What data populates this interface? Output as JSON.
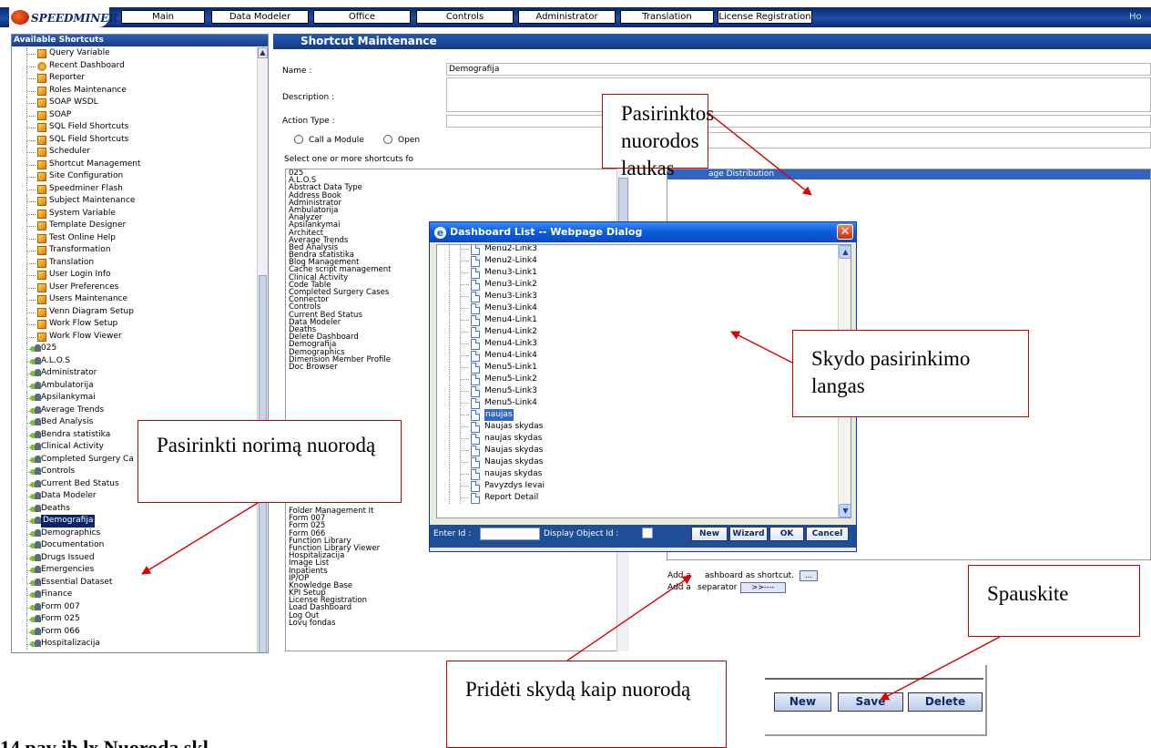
{
  "app": {
    "logo_text": "SPEEDMINER",
    "nav": [
      "Main",
      "Data Modeler",
      "Office",
      "Controls",
      "Administrator",
      "Translation",
      "License Registration"
    ],
    "nav_overflow": "Ho"
  },
  "sidebar": {
    "title": "Available Shortcuts",
    "items": [
      {
        "label": "Query Variable",
        "kind": "shortcut"
      },
      {
        "label": "Recent Dashboard",
        "kind": "recent"
      },
      {
        "label": "Reporter",
        "kind": "shortcut"
      },
      {
        "label": "Roles Maintenance",
        "kind": "shortcut"
      },
      {
        "label": "SOAP WSDL",
        "kind": "shortcut"
      },
      {
        "label": "SOAP",
        "kind": "shortcut"
      },
      {
        "label": "SQL Field Shortcuts",
        "kind": "shortcut"
      },
      {
        "label": "SQL Field Shortcuts",
        "kind": "shortcut"
      },
      {
        "label": "Scheduler",
        "kind": "shortcut"
      },
      {
        "label": "Shortcut Management",
        "kind": "shortcut"
      },
      {
        "label": "Site Configuration",
        "kind": "shortcut"
      },
      {
        "label": "Speedminer Flash",
        "kind": "shortcut"
      },
      {
        "label": "Subject Maintenance",
        "kind": "shortcut"
      },
      {
        "label": "System Variable",
        "kind": "shortcut"
      },
      {
        "label": "Template Designer",
        "kind": "shortcut"
      },
      {
        "label": "Test Online Help",
        "kind": "shortcut"
      },
      {
        "label": "Transformation",
        "kind": "shortcut"
      },
      {
        "label": "Translation",
        "kind": "shortcut"
      },
      {
        "label": "User Login Info",
        "kind": "shortcut"
      },
      {
        "label": "User Preferences",
        "kind": "shortcut"
      },
      {
        "label": "Users Maintenance",
        "kind": "shortcut"
      },
      {
        "label": "Venn Diagram Setup",
        "kind": "shortcut"
      },
      {
        "label": "Work Flow Setup",
        "kind": "shortcut"
      },
      {
        "label": "Work Flow Viewer",
        "kind": "shortcut"
      },
      {
        "label": "025",
        "kind": "dashboard"
      },
      {
        "label": "A.L.O.S",
        "kind": "dashboard"
      },
      {
        "label": "Administrator",
        "kind": "dashboard"
      },
      {
        "label": "Ambulatorija",
        "kind": "dashboard"
      },
      {
        "label": "Apsilankymai",
        "kind": "dashboard"
      },
      {
        "label": "Average Trends",
        "kind": "dashboard"
      },
      {
        "label": "Bed Analysis",
        "kind": "dashboard"
      },
      {
        "label": "Bendra statistika",
        "kind": "dashboard"
      },
      {
        "label": "Clinical Activity",
        "kind": "dashboard"
      },
      {
        "label": "Completed Surgery Ca",
        "kind": "dashboard"
      },
      {
        "label": "Controls",
        "kind": "dashboard"
      },
      {
        "label": "Current Bed Status",
        "kind": "dashboard"
      },
      {
        "label": "Data Modeler",
        "kind": "dashboard"
      },
      {
        "label": "Deaths",
        "kind": "dashboard"
      },
      {
        "label": "Demografija",
        "kind": "dashboard",
        "selected": true
      },
      {
        "label": "Demographics",
        "kind": "dashboard"
      },
      {
        "label": "Documentation",
        "kind": "dashboard"
      },
      {
        "label": "Drugs Issued",
        "kind": "dashboard"
      },
      {
        "label": "Emergencies",
        "kind": "dashboard"
      },
      {
        "label": "Essential Dataset",
        "kind": "dashboard"
      },
      {
        "label": "Finance",
        "kind": "dashboard"
      },
      {
        "label": "Form 007",
        "kind": "dashboard"
      },
      {
        "label": "Form 025",
        "kind": "dashboard"
      },
      {
        "label": "Form 066",
        "kind": "dashboard"
      },
      {
        "label": "Hospitalizacija",
        "kind": "dashboard"
      }
    ]
  },
  "main": {
    "title": "Shortcut Maintenance",
    "name_label": "Name :",
    "name_value": "Demografija",
    "description_label": "Description :",
    "action_type_label": "Action Type :",
    "radio_call_module": "Call a Module",
    "radio_open_partial": "Open",
    "select_label": "Select one or more shortcuts fo",
    "available_list": [
      "025",
      "A.L.O.S",
      "Abstract Data Type",
      "Address Book",
      "Administrator",
      "Ambulatorija",
      "Analyzer",
      "Apsilankymai",
      "Architect",
      "Average Trends",
      "Bed Analysis",
      "Bendra statistika",
      "Blog Management",
      "Cache script management",
      "Clinical Activity",
      "Code Table",
      "Completed Surgery Cases",
      "Connector",
      "Controls",
      "Current Bed Status",
      "Data Modeler",
      "Deaths",
      "Delete Dashboard",
      "Demografija",
      "Demographics",
      "Dimension Member Profile",
      "Doc Browser"
    ],
    "available_list_bottom": [
      "Folder Management It",
      "Form 007",
      "Form 025",
      "Form 066",
      "Function Library",
      "Function Library Viewer",
      "Hospitalizacija",
      "Image List",
      "Inpatients",
      "IP/OP",
      "Knowledge Base",
      "KPI Setup",
      "License Registration",
      "Load Dashboard",
      "Log Out",
      "Lovų fondas"
    ],
    "selected_row_partial": "age Distribution",
    "add_dashboard_label_a": "Add a",
    "add_dashboard_label_b": "ashboard as shortcut.",
    "add_dashboard_btn": "...",
    "add_separator_label_a": "Add a",
    "add_separator_label_b": "separator",
    "add_separator_btn": ">>----"
  },
  "buttons": {
    "new": "New",
    "save": "Save",
    "delete": "Delete"
  },
  "dialog": {
    "title": "Dashboard List -- Webpage Dialog",
    "ie_icon": "e",
    "close": "✕",
    "items": [
      {
        "label": "Menu2-Link3"
      },
      {
        "label": "Menu2-Link4"
      },
      {
        "label": "Menu3-Link1"
      },
      {
        "label": "Menu3-Link2"
      },
      {
        "label": "Menu3-Link3"
      },
      {
        "label": "Menu3-Link4"
      },
      {
        "label": "Menu4-Link1"
      },
      {
        "label": "Menu4-Link2"
      },
      {
        "label": "Menu4-Link3"
      },
      {
        "label": "Menu4-Link4"
      },
      {
        "label": "Menu5-Link1"
      },
      {
        "label": "Menu5-Link2"
      },
      {
        "label": "Menu5-Link3"
      },
      {
        "label": "Menu5-Link4"
      },
      {
        "label": "naujas",
        "selected": true
      },
      {
        "label": "Naujas skydas"
      },
      {
        "label": "naujas skydas"
      },
      {
        "label": "Naujas skydas"
      },
      {
        "label": "Naujas skydas"
      },
      {
        "label": "naujas skydas"
      },
      {
        "label": "Pavyzdys Ievai"
      },
      {
        "label": "Report Detail"
      }
    ],
    "enter_id_label": "Enter Id :",
    "display_object_id_label": "Display Object Id :",
    "btn_new": "New",
    "btn_wizard": "Wizard",
    "btn_ok": "OK",
    "btn_cancel": "Cancel"
  },
  "annotations": {
    "selected_field": "Pasirinktos nuorodos laukas",
    "dialog_window": "Skydo pasirinkimo langas",
    "choose_shortcut": "Pasirinkti norimą nuorodą",
    "press": "Spauskite",
    "add_dashboard": "Pridėti skydą kaip nuorodą",
    "arrow_color": "#dd0000"
  },
  "footer_text": "14 pav ib lx  Nuoroda skl"
}
